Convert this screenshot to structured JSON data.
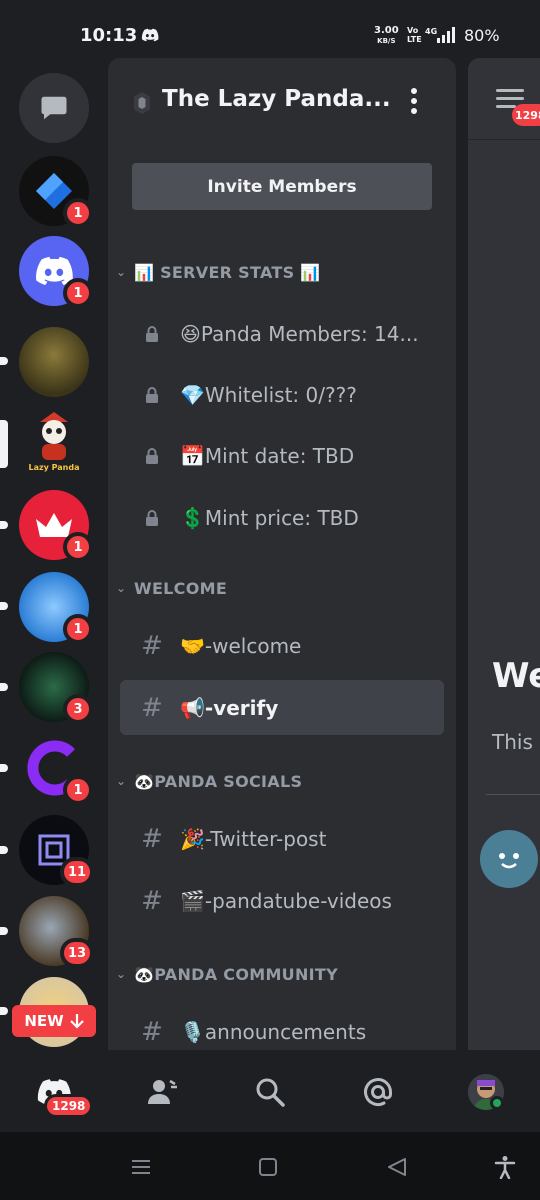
{
  "status_bar": {
    "time": "10:13",
    "net_speed_value": "3.00",
    "net_speed_unit": "KB/S",
    "volte_top": "Vo",
    "volte_bottom": "LTE",
    "network": "4G",
    "battery": "80%"
  },
  "rail": {
    "servers": [
      {
        "name": "direct-messages",
        "badge": ""
      },
      {
        "name": "server-blue-diamond",
        "badge": "1",
        "color": "#1f6fe0"
      },
      {
        "name": "server-discord",
        "badge": "1",
        "color": "#5865f2"
      },
      {
        "name": "server-pirate",
        "badge": "",
        "color": "#6b5a2a"
      },
      {
        "name": "server-lazy-panda",
        "badge": "",
        "color": "#1e1f22"
      },
      {
        "name": "server-crown",
        "badge": "1",
        "color": "#e8213a"
      },
      {
        "name": "server-whale",
        "badge": "1",
        "color": "#37a6e0"
      },
      {
        "name": "server-neon",
        "badge": "3",
        "color": "#163a2c"
      },
      {
        "name": "server-purple-c",
        "badge": "1",
        "color": "#1e1f22"
      },
      {
        "name": "server-box",
        "badge": "11",
        "color": "#0b0b12"
      },
      {
        "name": "server-orb",
        "badge": "13",
        "color": "#7a5a3a"
      },
      {
        "name": "server-cheese",
        "badge": "",
        "color": "#d9c7a0"
      }
    ],
    "new_label": "NEW"
  },
  "panel": {
    "server_name": "The Lazy Panda...",
    "invite_label": "Invite Members",
    "categories": [
      {
        "label": "📊 SERVER STATS 📊"
      },
      {
        "label": "WELCOME"
      },
      {
        "label": "🐼PANDA SOCIALS"
      },
      {
        "label": "🐼PANDA COMMUNITY"
      }
    ],
    "channels": [
      {
        "name": "😆Panda Members: 14...",
        "locked": true
      },
      {
        "name": "💎Whitelist: 0/???",
        "locked": true
      },
      {
        "name": "📅Mint date: TBD",
        "locked": true
      },
      {
        "name": "💲Mint price: TBD",
        "locked": true
      },
      {
        "name": "🤝-welcome",
        "locked": false
      },
      {
        "name": "📢-verify",
        "locked": false,
        "active": true
      },
      {
        "name": "🎉-Twitter-post",
        "locked": false
      },
      {
        "name": "🎬-pandatube-videos",
        "locked": false
      },
      {
        "name": "🎙️announcements",
        "locked": false
      }
    ]
  },
  "chat": {
    "badge": "1298",
    "welcome_title": "We",
    "welcome_sub": "This"
  },
  "bottom_nav": {
    "home_badge": "1298"
  },
  "colors": {
    "accent_red": "#f23f43",
    "panel_bg": "#2b2d31",
    "rail_bg": "#1e1f22",
    "active_channel": "#404249"
  }
}
